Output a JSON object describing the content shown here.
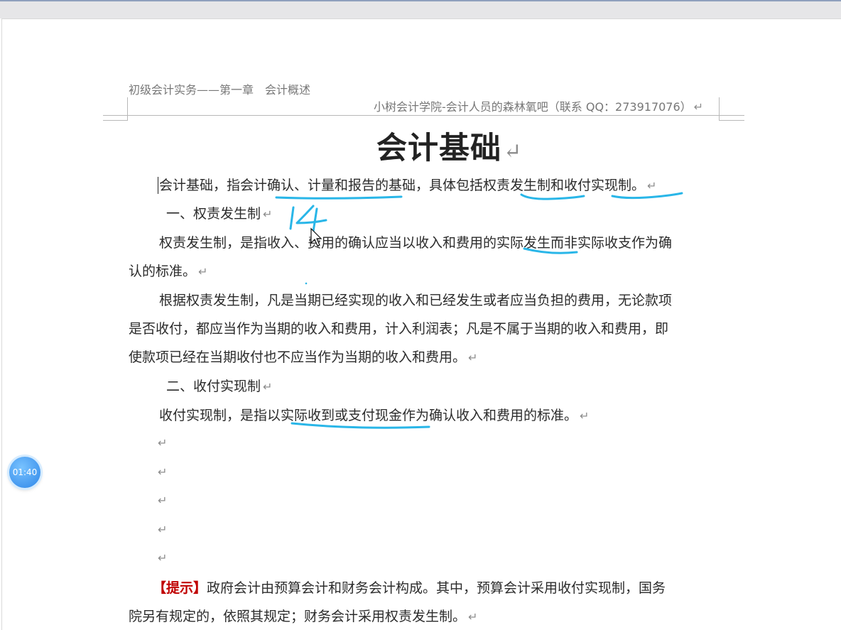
{
  "header": {
    "left": "初级会计实务——第一章　会计概述",
    "right": "小树会计学院-会计人员的森林氧吧（联系 QQ：273917076）"
  },
  "doc": {
    "title": "会计基础",
    "p1": "会计基础，指会计确认、计量和报告的基础，具体包括权责发生制和收付实现制。",
    "h1": "一、权责发生制",
    "p2_line1": "权责发生制，是指收入、费用的确认应当以收入和费用的实际发生而非实际收支作为确",
    "p2_line2": "认的标准。",
    "p3_line1": "根据权责发生制，凡是当期已经实现的收入和已经发生或者应当负担的费用，无论款项",
    "p3_line2": "是否收付，都应当作为当期的收入和费用，计入利润表；凡是不属于当期的收入和费用，即",
    "p3_line3": "使款项已经在当期收付也不应当作为当期的收入和费用。",
    "h2": "二、收付实现制",
    "p4": "收付实现制，是指以实际收到或支付现金作为确认收入和费用的标准。",
    "tip_label": "【提示】",
    "tip_line1": "政府会计由预算会计和财务会计构成。其中，预算会计采用收付实现制，国务",
    "tip_line2": "院另有规定的，依照其规定；财务会计采用权责发生制。",
    "paragraph_mark": "↵"
  },
  "annotation": {
    "handwritten": "14",
    "ink_color": "#29b6e8"
  },
  "timer": {
    "label": "01:40"
  },
  "colors": {
    "accent_tip": "#c00000",
    "text": "#2b2b2b",
    "header_text": "#777777"
  }
}
